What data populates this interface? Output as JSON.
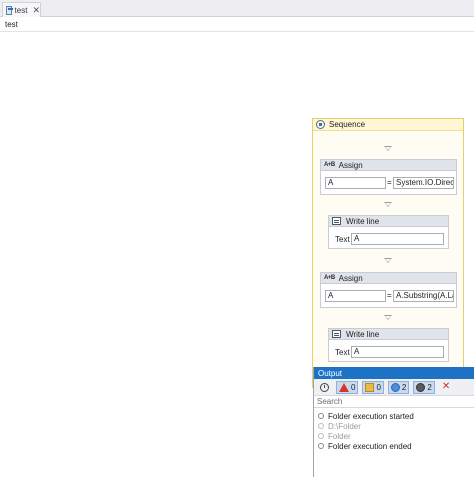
{
  "tab": {
    "label": "test",
    "close_glyph": "✕",
    "icon": "workflow-doc-icon"
  },
  "breadcrumb": "test",
  "sequence": {
    "title": "Sequence",
    "activities": [
      {
        "type": "Assign",
        "title": "Assign",
        "to": "A",
        "eq": "=",
        "value": "System.IO.Director"
      },
      {
        "type": "WriteLine",
        "title": "Write line",
        "text_label": "Text",
        "text_value": "A"
      },
      {
        "type": "Assign",
        "title": "Assign",
        "to": "A",
        "eq": "=",
        "value": "A.Substring(A.Last"
      },
      {
        "type": "WriteLine",
        "title": "Write line",
        "text_label": "Text",
        "text_value": "A"
      }
    ]
  },
  "output": {
    "title": "Output",
    "toolbar": {
      "errors": "0",
      "warnings": "0",
      "info": "2",
      "verbose": "2"
    },
    "search_placeholder": "Search",
    "log": [
      {
        "text": "Folder execution started",
        "dim": false
      },
      {
        "text": "D:\\Folder",
        "dim": true
      },
      {
        "text": "Folder",
        "dim": true
      },
      {
        "text": "Folder execution ended",
        "dim": false
      }
    ]
  },
  "colors": {
    "accent": "#1e72c6",
    "sequence_border": "#e8cd6b",
    "error": "#d9362b"
  }
}
